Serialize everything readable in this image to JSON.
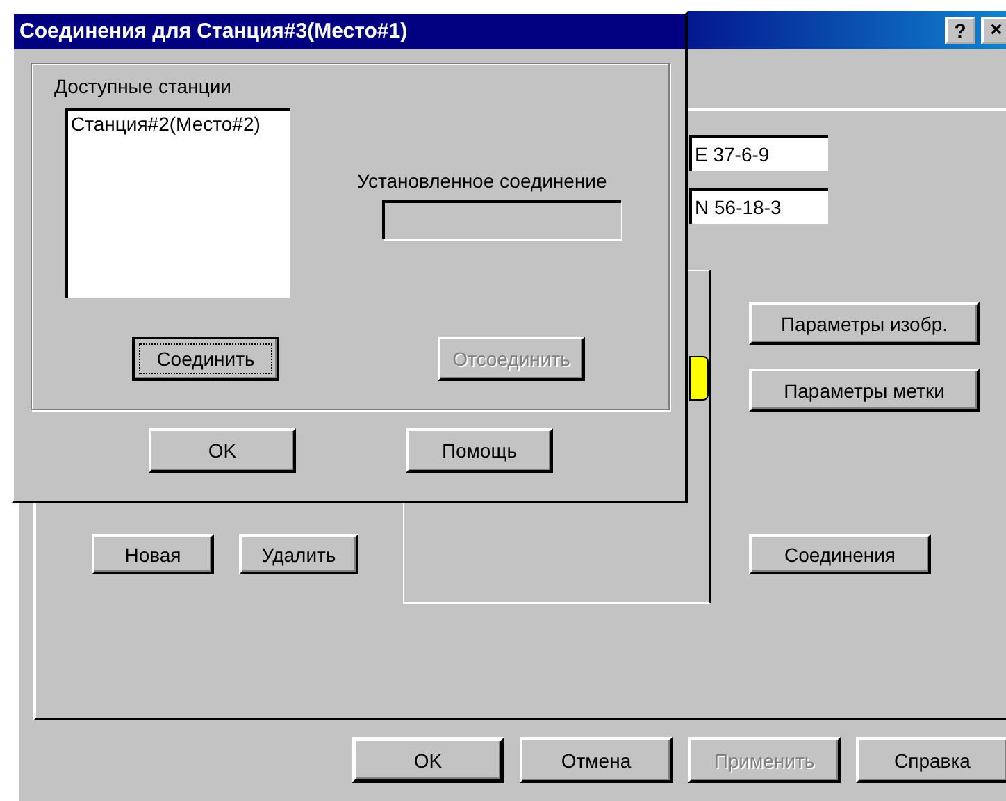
{
  "back_dialog": {
    "title_buttons": [
      {
        "kind": "help",
        "label": "?"
      },
      {
        "kind": "close",
        "label": "×"
      }
    ],
    "fields": [
      {
        "value": "E 37-6-9"
      },
      {
        "value": "N 56-18-3"
      }
    ],
    "side_buttons": [
      {
        "label": "Параметры изобр.",
        "disabled": false
      },
      {
        "label": "Параметры метки",
        "disabled": false
      }
    ],
    "connections_button": {
      "label": "Соединения",
      "disabled": false
    },
    "list_buttons": [
      {
        "label": "Новая",
        "disabled": false
      },
      {
        "label": "Удалить",
        "disabled": false
      }
    ],
    "buttons": [
      {
        "label": "OK",
        "disabled": false,
        "default": true
      },
      {
        "label": "Отмена",
        "disabled": false,
        "default": false
      },
      {
        "label": "Применить",
        "disabled": true,
        "default": false
      },
      {
        "label": "Справка",
        "disabled": false,
        "default": false
      }
    ]
  },
  "dialog": {
    "title": "Соединения для Станция#3(Место#1)",
    "available_label": "Доступные станции",
    "stations": [
      {
        "name": "Станция#2(Место#2)",
        "selected": false
      }
    ],
    "established_label": "Установленное соединение",
    "group_buttons": [
      {
        "label": "Соединить",
        "disabled": false,
        "default": true
      },
      {
        "label": "Отсоединить",
        "disabled": true,
        "default": false
      }
    ],
    "buttons": [
      {
        "label": "OK",
        "disabled": false,
        "default": false
      },
      {
        "label": "Помощь",
        "disabled": false,
        "default": false
      }
    ]
  }
}
